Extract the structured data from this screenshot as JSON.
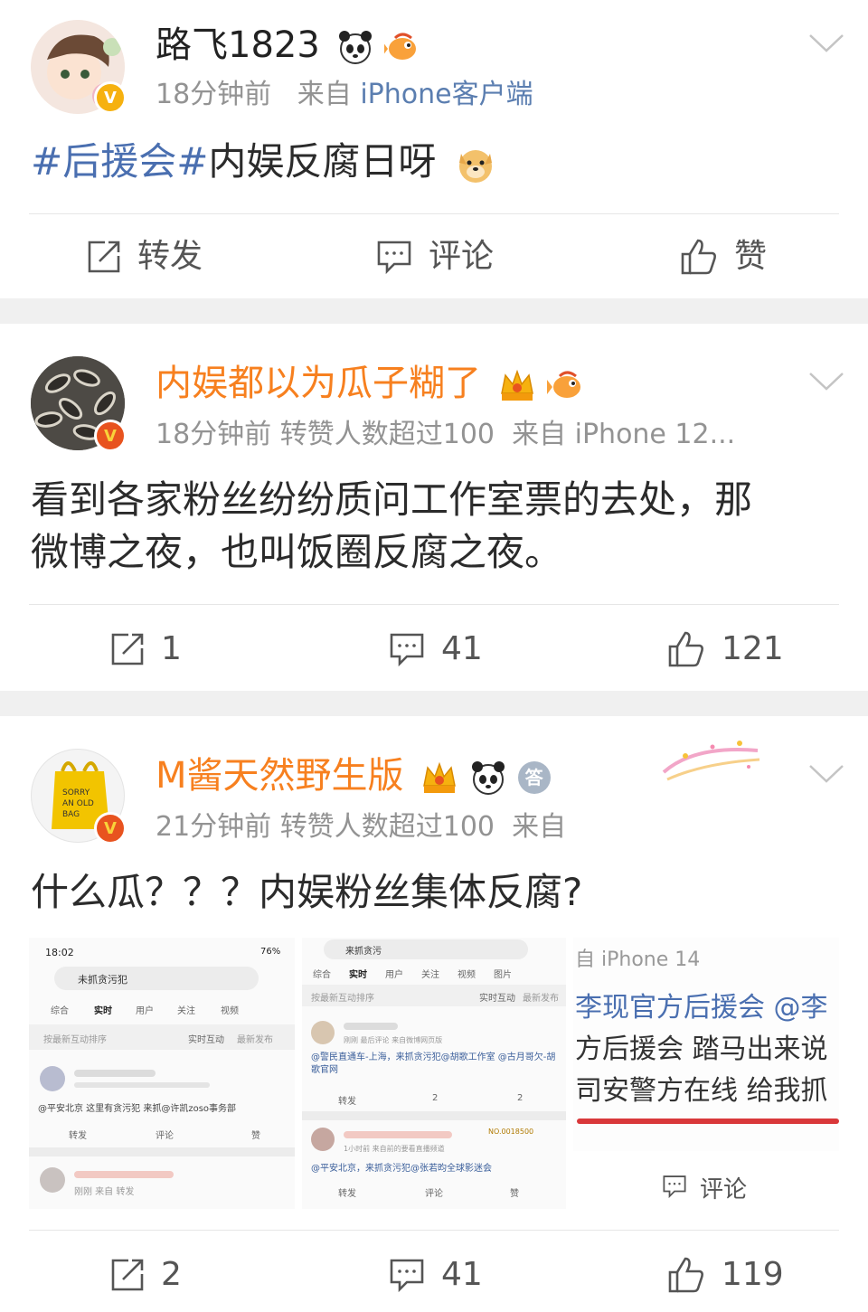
{
  "colors": {
    "topic": "#4a6fb0",
    "vip_name": "#f7801f",
    "meta": "#939393",
    "source_link": "#5b7eb0",
    "verify_badge": "#f6b10f",
    "verify_badge_orange": "#e8531f",
    "separator": "#f0f0f0"
  },
  "posts": [
    {
      "username": "路飞1823",
      "time": "18分钟前",
      "extra": "",
      "source_prefix": "来自",
      "source": "iPhone客户端",
      "topic": "#后援会#",
      "text": "内娱反腐日呀",
      "actions": {
        "repost": "转发",
        "comment": "评论",
        "like": "赞"
      }
    },
    {
      "username": "内娱都以为瓜子糊了",
      "time": "18分钟前",
      "extra": "转赞人数超过100",
      "source_prefix": "来自",
      "source": "iPhone 12...",
      "text_line1": "看到各家粉丝纷纷质问工作室票的去处，那",
      "text_line2": "微博之夜，也叫饭圈反腐之夜。",
      "actions": {
        "repost": "1",
        "comment": "41",
        "like": "121"
      }
    },
    {
      "username": "M酱天然野生版",
      "time": "21分钟前",
      "extra": "转赞人数超过100",
      "source_prefix": "来自",
      "text": "什么瓜？？？内娱粉丝集体反腐?",
      "badge_char": "答",
      "actions": {
        "repost": "2",
        "comment": "41",
        "like": "119"
      },
      "images": {
        "shot1": {
          "status_time": "18:02",
          "battery": "76%",
          "search": "未抓贪污犯",
          "tabs": [
            "综合",
            "实时",
            "用户",
            "关注",
            "视频"
          ],
          "sort": "按最新互动排序",
          "sort_btns": [
            "实时互动",
            "最新发布"
          ],
          "post_text": "@平安北京 这里有贪污犯 来抓@许凯zoso事务部",
          "acts": [
            "转发",
            "评论",
            "赞"
          ],
          "post2_meta": "刚刚 来自 转发"
        },
        "shot2": {
          "search": "来抓贪污",
          "tabs": [
            "综合",
            "实时",
            "用户",
            "关注",
            "视频",
            "图片"
          ],
          "sort": "按最新互动排序",
          "sort_btns": [
            "实时互动",
            "最新发布"
          ],
          "p1_meta": "刚刚 最后评论 来自微博网页版",
          "p1_text": "@警民直通车-上海，来抓贪污犯@胡歌工作室 @古月哥欠-胡歌官网",
          "p1_acts": [
            "转发",
            "2",
            "2"
          ],
          "p2_meta": "1小时前 来自前的要看直播频道",
          "p2_badge": "NO.0018500",
          "p2_text": "@平安北京，来抓贪污犯@张若昀全球影迷会",
          "p2_acts": [
            "转发",
            "评论",
            "赞"
          ]
        },
        "shot3": {
          "line0": "自 iPhone 14",
          "line1": "李现官方后援会 @李",
          "line2": "方后援会 踏马出来说",
          "line3": "司安警方在线 给我抓",
          "comment": "评论"
        }
      }
    }
  ]
}
